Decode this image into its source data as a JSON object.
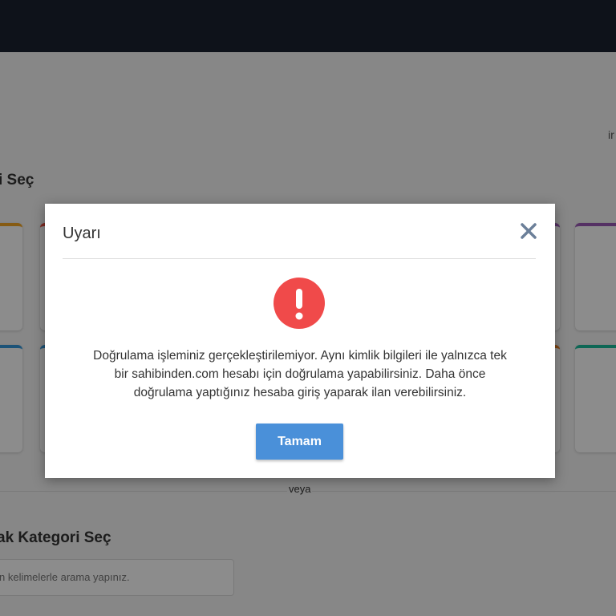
{
  "background": {
    "right_text": "ir",
    "heading_1": "i Seç",
    "heading_2": "ak Kategori Seç",
    "separator_text": "veya",
    "search_placeholder": "n kelimelerle arama yapınız."
  },
  "colors": {
    "topbar": "#1b2130",
    "card_accents": [
      "#f5a623",
      "#e74c3c",
      "#9b59b6",
      "#3498db",
      "#e67e22",
      "#1abc9c"
    ],
    "alert_icon": "#f04a4a",
    "primary_button": "#4a90d9"
  },
  "modal": {
    "title": "Uyarı",
    "close_icon": "close-icon",
    "alert_icon": "exclamation-icon",
    "message_lines": [
      "Doğrulama işleminiz gerçekleştirilemiyor. Aynı kimlik bilgileri ile yalnızca tek",
      "bir sahibinden.com hesabı için doğrulama yapabilirsiniz. Daha önce",
      "doğrulama yaptığınız hesaba giriş yaparak ilan verebilirsiniz."
    ],
    "ok_label": "Tamam"
  }
}
